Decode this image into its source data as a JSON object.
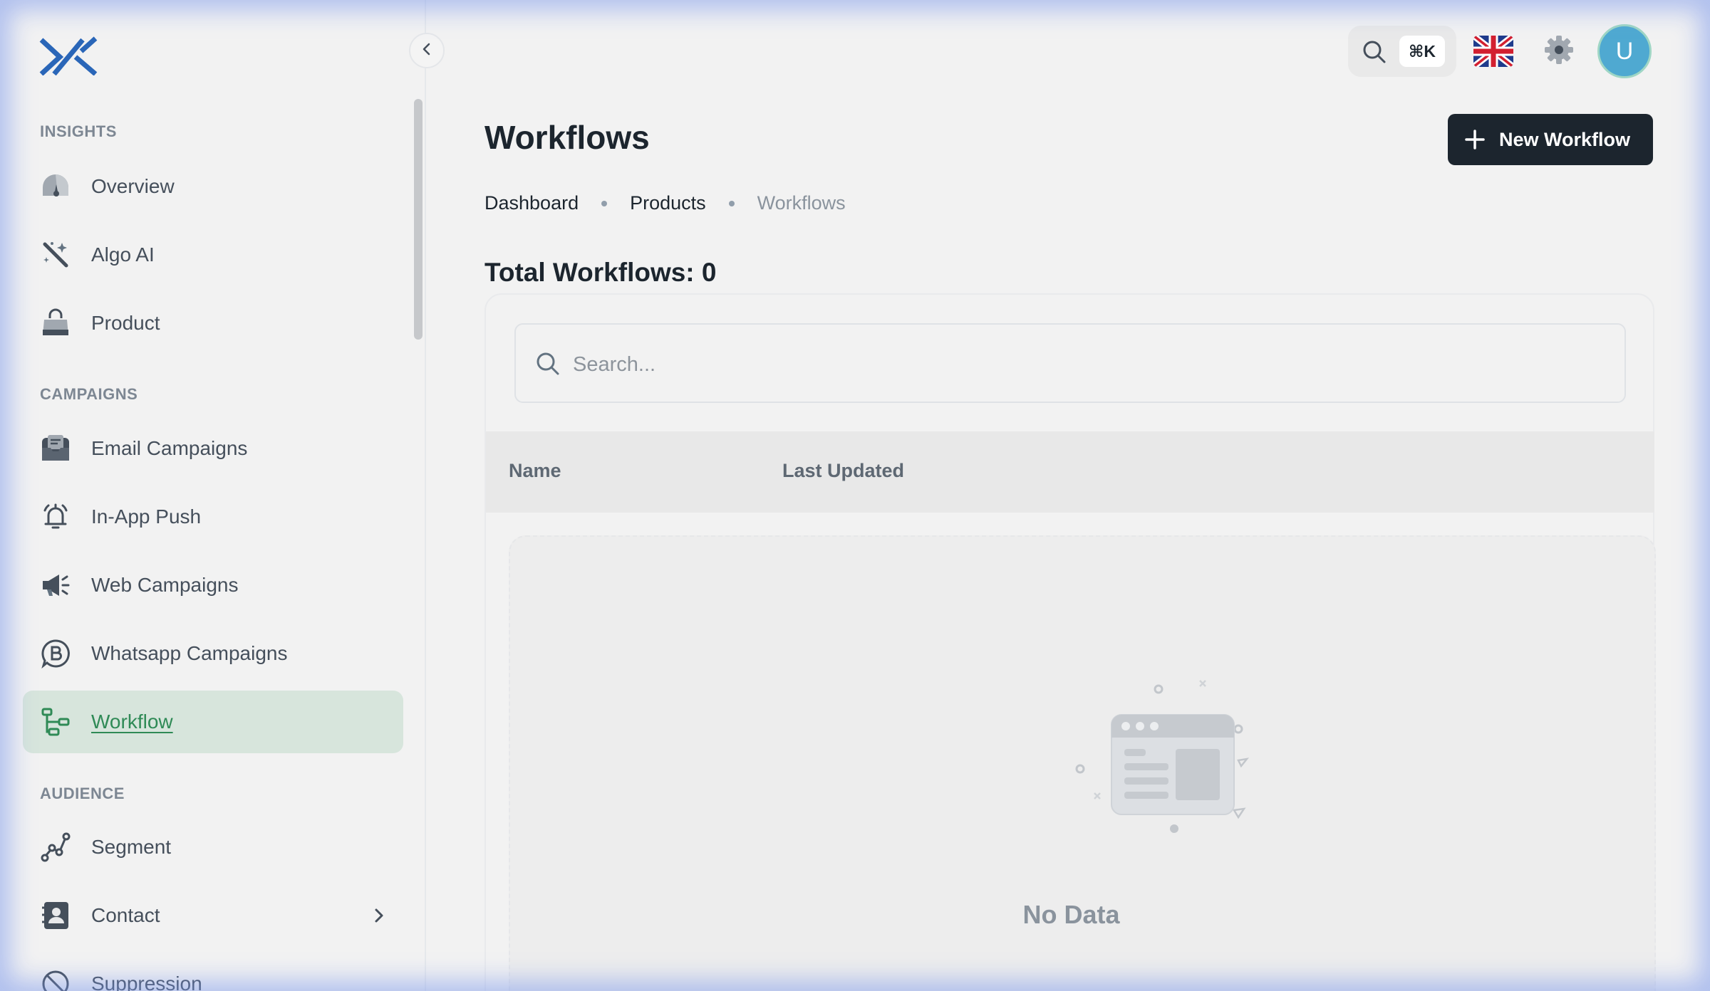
{
  "sidebar": {
    "sections": [
      {
        "title": "INSIGHTS"
      },
      {
        "title": "CAMPAIGNS"
      },
      {
        "title": "AUDIENCE"
      }
    ],
    "items": [
      {
        "label": "Overview",
        "icon": "dashboard-gauge-icon"
      },
      {
        "label": "Algo AI",
        "icon": "magic-wand-icon"
      },
      {
        "label": "Product",
        "icon": "shopping-bag-icon"
      },
      {
        "label": "Email Campaigns",
        "icon": "mail-inbox-icon"
      },
      {
        "label": "In-App Push",
        "icon": "bell-ring-icon"
      },
      {
        "label": "Web Campaigns",
        "icon": "megaphone-icon"
      },
      {
        "label": "Whatsapp Campaigns",
        "icon": "whatsapp-business-icon"
      },
      {
        "label": "Workflow",
        "icon": "workflow-icon",
        "active": true
      },
      {
        "label": "Segment",
        "icon": "segment-graph-icon"
      },
      {
        "label": "Contact",
        "icon": "contact-card-icon",
        "has_submenu": true
      },
      {
        "label": "Suppression",
        "icon": "block-icon"
      }
    ]
  },
  "topbar": {
    "shortcut": "⌘K",
    "language_icon": "uk-flag-icon",
    "avatar_initial": "U"
  },
  "page": {
    "title": "Workflows",
    "new_button": "New Workflow",
    "breadcrumb": [
      "Dashboard",
      "Products",
      "Workflows"
    ],
    "total_label": "Total Workflows: 0"
  },
  "table": {
    "search_placeholder": "Search...",
    "columns": [
      "Name",
      "Last Updated"
    ],
    "rows": [],
    "empty_text": "No Data"
  },
  "colors": {
    "accent": "#2f8a56",
    "active_bg": "#d7e5dc",
    "primary_button": "#1c252e",
    "avatar": "#4fa9d1"
  }
}
